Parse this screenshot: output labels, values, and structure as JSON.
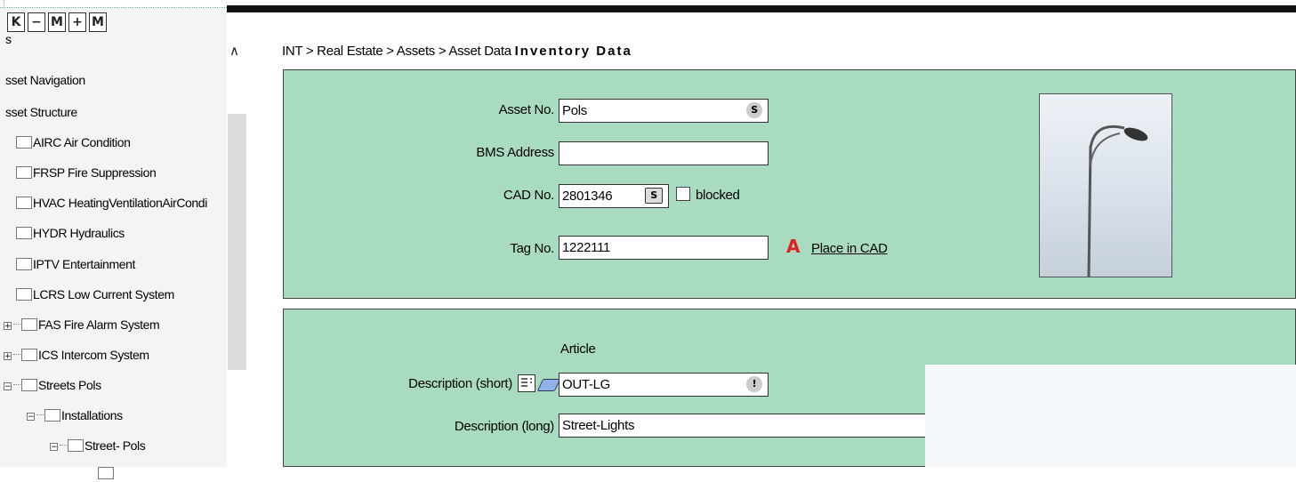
{
  "nav_buttons": [
    "K",
    "−",
    "M",
    "+",
    "M"
  ],
  "tree": {
    "items": [
      {
        "label": "s"
      },
      {
        "label": "sset Navigation"
      },
      {
        "label": "sset Structure"
      },
      {
        "label": "AIRC Air Condition"
      },
      {
        "label": "FRSP Fire Suppression"
      },
      {
        "label": "HVAC HeatingVentilationAirCondi"
      },
      {
        "label": "HYDR Hydraulics"
      },
      {
        "label": "IPTV Entertainment"
      },
      {
        "label": "LCRS Low Current System"
      },
      {
        "label": "FAS Fire Alarm System"
      },
      {
        "label": "ICS Intercom System"
      },
      {
        "label": "Streets Pols"
      },
      {
        "label": "Installations"
      },
      {
        "label": "Street- Pols"
      }
    ]
  },
  "breadcrumb": {
    "path": "INT > Real Estate > Assets > Asset Data",
    "current": "Inventory Data"
  },
  "form": {
    "asset_no": {
      "label": "Asset No.",
      "value": "Pols",
      "badge": "S"
    },
    "bms_address": {
      "label": "BMS Address",
      "value": ""
    },
    "cad_no": {
      "label": "CAD No.",
      "value": "2801346",
      "badge": "S",
      "checkbox_label": "blocked"
    },
    "tag_no": {
      "label": "Tag No.",
      "value": "1222111",
      "link": "Place in CAD"
    }
  },
  "article": {
    "heading": "Article",
    "desc_short": {
      "label": "Description (short)",
      "value": "OUT-LG",
      "badge": "!"
    },
    "desc_long": {
      "label": "Description (long)",
      "value": "Street-Lights"
    }
  },
  "colors": {
    "panel_bg": "#a8dbc0",
    "cad_icon": "#dd2222"
  },
  "icons": [
    "first-page-icon",
    "collapse-icon",
    "scroll-up-icon",
    "folder-icon",
    "cad-icon",
    "note-icon",
    "eraser-icon",
    "street-lamp-photo"
  ]
}
